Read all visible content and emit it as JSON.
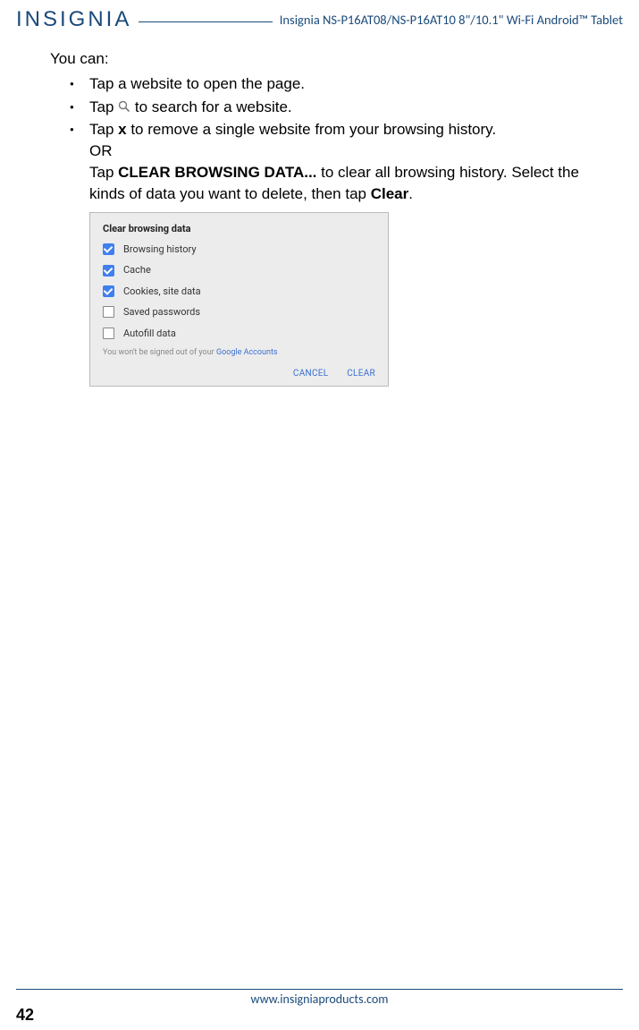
{
  "header": {
    "brand": "INSIGNIA",
    "title": "Insignia  NS-P16AT08/NS-P16AT10  8\"/10.1\" Wi-Fi Android™ Tablet"
  },
  "content": {
    "youcan": "You can:",
    "bullet1": "Tap a website to open the page.",
    "bullet2_pre": "Tap ",
    "bullet2_post": " to search for a website.",
    "bullet3_pre": "Tap ",
    "bullet3_x": "x",
    "bullet3_post": " to remove a single website from your browsing history.",
    "bullet3_or": "OR",
    "bullet3_line2a": "Tap ",
    "bullet3_clear_browsing": "CLEAR BROWSING DATA...",
    "bullet3_line2b": " to clear all browsing history. Select the kinds of data you want to delete, then tap ",
    "bullet3_clear": "Clear",
    "bullet3_period": "."
  },
  "dialog": {
    "title": "Clear browsing data",
    "items": [
      {
        "label": "Browsing history",
        "checked": true
      },
      {
        "label": "Cache",
        "checked": true
      },
      {
        "label": "Cookies, site data",
        "checked": true
      },
      {
        "label": "Saved passwords",
        "checked": false
      },
      {
        "label": "Autofill data",
        "checked": false
      }
    ],
    "note_pre": "You won't be signed out of your ",
    "note_link": "Google Accounts",
    "cancel": "CANCEL",
    "clear": "CLEAR"
  },
  "footer": {
    "url": "www.insigniaproducts.com",
    "page": "42"
  }
}
